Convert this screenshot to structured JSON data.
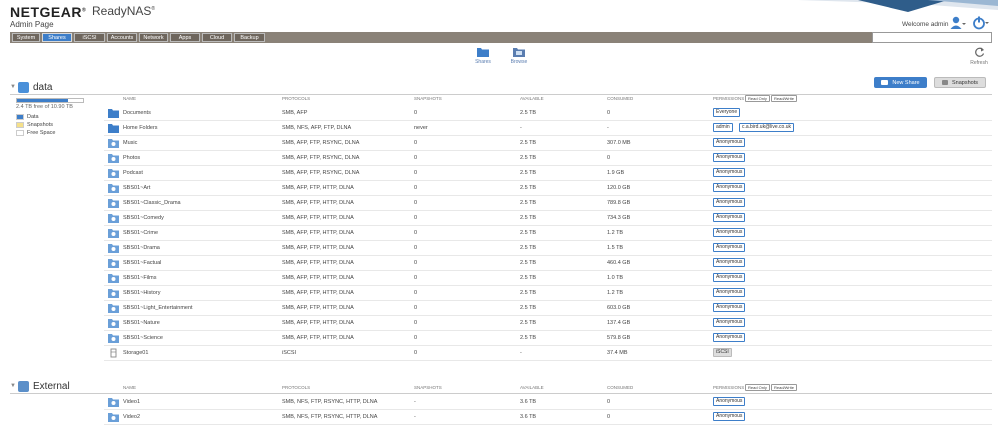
{
  "header": {
    "brand": "NETGEAR",
    "brand_mark": "®",
    "product": "ReadyNAS",
    "product_mark": "®",
    "page_title": "Admin Page",
    "welcome": "Welcome admin"
  },
  "nav": {
    "tabs": [
      {
        "label": "System"
      },
      {
        "label": "Shares",
        "active": true
      },
      {
        "label": "iSCSI"
      },
      {
        "label": "Accounts"
      },
      {
        "label": "Network"
      },
      {
        "label": "Apps"
      },
      {
        "label": "Cloud"
      },
      {
        "label": "Backup"
      }
    ],
    "search_value": ""
  },
  "subnav": {
    "shares": "Shares",
    "browse": "Browse",
    "refresh": "Refresh"
  },
  "toolbar": {
    "new_share": "New Share",
    "snapshots": "Snapshots"
  },
  "columns": {
    "name": "NAME",
    "protocols": "PROTOCOLS",
    "snapshots": "SNAPSHOTS",
    "available": "AVAILABLE",
    "consumed": "CONSUMED",
    "permissions": "PERMISSIONS",
    "read_only": "Read Only",
    "read_write": "Read/Write"
  },
  "data_volume": {
    "name": "data",
    "usage_text": "2.4 TB free of 10.90 TB",
    "used_fraction": 0.78,
    "legend": [
      {
        "label": "Data",
        "color": "#3d7ec9"
      },
      {
        "label": "Snapshots",
        "color": "#f5e08a"
      },
      {
        "label": "Free Space",
        "color": "#ffffff"
      }
    ],
    "rows": [
      {
        "name": "Documents",
        "icon": "folder-icon",
        "protocols": "SMB, AFP",
        "snapshots": "0",
        "available": "2.5 TB",
        "consumed": "0",
        "perms": [
          "Everyone"
        ]
      },
      {
        "name": "Home Folders",
        "icon": "folder-icon",
        "protocols": "SMB, NFS, AFP, FTP, DLNA",
        "snapshots": "never",
        "available": "-",
        "consumed": "-",
        "perms": [
          "admin",
          "c.a.bird.uk@live.co.uk"
        ]
      },
      {
        "name": "Music",
        "icon": "share-icon",
        "protocols": "SMB, AFP, FTP, RSYNC, DLNA",
        "snapshots": "0",
        "available": "2.5 TB",
        "consumed": "307.0 MB",
        "perms": [
          "Anonymous"
        ]
      },
      {
        "name": "Photos",
        "icon": "share-icon",
        "protocols": "SMB, AFP, FTP, RSYNC, DLNA",
        "snapshots": "0",
        "available": "2.5 TB",
        "consumed": "0",
        "perms": [
          "Anonymous"
        ]
      },
      {
        "name": "Podcast",
        "icon": "share-icon",
        "protocols": "SMB, AFP, FTP, RSYNC, DLNA",
        "snapshots": "0",
        "available": "2.5 TB",
        "consumed": "1.9 GB",
        "perms": [
          "Anonymous"
        ]
      },
      {
        "name": "SBS01~Art",
        "icon": "share-icon",
        "protocols": "SMB, AFP, FTP, HTTP, DLNA",
        "snapshots": "0",
        "available": "2.5 TB",
        "consumed": "120.0 GB",
        "perms": [
          "Anonymous"
        ]
      },
      {
        "name": "SBS01~Classic_Drama",
        "icon": "share-icon",
        "protocols": "SMB, AFP, FTP, HTTP, DLNA",
        "snapshots": "0",
        "available": "2.5 TB",
        "consumed": "789.8 GB",
        "perms": [
          "Anonymous"
        ]
      },
      {
        "name": "SBS01~Comedy",
        "icon": "share-icon",
        "protocols": "SMB, AFP, FTP, HTTP, DLNA",
        "snapshots": "0",
        "available": "2.5 TB",
        "consumed": "734.3 GB",
        "perms": [
          "Anonymous"
        ]
      },
      {
        "name": "SBS01~Crime",
        "icon": "share-icon",
        "protocols": "SMB, AFP, FTP, HTTP, DLNA",
        "snapshots": "0",
        "available": "2.5 TB",
        "consumed": "1.2 TB",
        "perms": [
          "Anonymous"
        ]
      },
      {
        "name": "SBS01~Drama",
        "icon": "share-icon",
        "protocols": "SMB, AFP, FTP, HTTP, DLNA",
        "snapshots": "0",
        "available": "2.5 TB",
        "consumed": "1.5 TB",
        "perms": [
          "Anonymous"
        ]
      },
      {
        "name": "SBS01~Factual",
        "icon": "share-icon",
        "protocols": "SMB, AFP, FTP, HTTP, DLNA",
        "snapshots": "0",
        "available": "2.5 TB",
        "consumed": "460.4 GB",
        "perms": [
          "Anonymous"
        ]
      },
      {
        "name": "SBS01~Films",
        "icon": "share-icon",
        "protocols": "SMB, AFP, FTP, HTTP, DLNA",
        "snapshots": "0",
        "available": "2.5 TB",
        "consumed": "1.0 TB",
        "perms": [
          "Anonymous"
        ]
      },
      {
        "name": "SBS01~History",
        "icon": "share-icon",
        "protocols": "SMB, AFP, FTP, HTTP, DLNA",
        "snapshots": "0",
        "available": "2.5 TB",
        "consumed": "1.2 TB",
        "perms": [
          "Anonymous"
        ]
      },
      {
        "name": "SBS01~Light_Entertainment",
        "icon": "share-icon",
        "protocols": "SMB, AFP, FTP, HTTP, DLNA",
        "snapshots": "0",
        "available": "2.5 TB",
        "consumed": "603.0 GB",
        "perms": [
          "Anonymous"
        ]
      },
      {
        "name": "SBS01~Nature",
        "icon": "share-icon",
        "protocols": "SMB, AFP, FTP, HTTP, DLNA",
        "snapshots": "0",
        "available": "2.5 TB",
        "consumed": "137.4 GB",
        "perms": [
          "Anonymous"
        ]
      },
      {
        "name": "SBS01~Science",
        "icon": "share-icon",
        "protocols": "SMB, AFP, FTP, HTTP, DLNA",
        "snapshots": "0",
        "available": "2.5 TB",
        "consumed": "579.8 GB",
        "perms": [
          "Anonymous"
        ]
      },
      {
        "name": "Storage01",
        "icon": "lun-icon",
        "protocols": "iSCSI",
        "snapshots": "0",
        "available": "-",
        "consumed": "37.4 MB",
        "perms": [
          "iSCSI"
        ]
      }
    ]
  },
  "external_volume": {
    "name": "External",
    "rows": [
      {
        "name": "Video1",
        "icon": "share-icon",
        "protocols": "SMB, NFS, FTP, RSYNC, HTTP, DLNA",
        "snapshots": "-",
        "available": "3.6 TB",
        "consumed": "0",
        "perms": [
          "Anonymous"
        ]
      },
      {
        "name": "Video2",
        "icon": "share-icon",
        "protocols": "SMB, NFS, FTP, RSYNC, HTTP, DLNA",
        "snapshots": "-",
        "available": "3.6 TB",
        "consumed": "0",
        "perms": [
          "Anonymous"
        ]
      }
    ]
  }
}
